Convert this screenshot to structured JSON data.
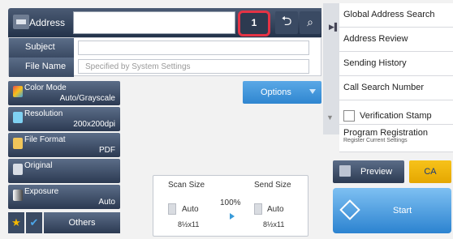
{
  "address": {
    "label": "Address",
    "count": "1"
  },
  "subject": {
    "label": "Subject"
  },
  "file_name": {
    "label": "File Name",
    "placeholder": "Specified by System Settings"
  },
  "modes": [
    {
      "title": "Color Mode",
      "value": "Auto/Grayscale"
    },
    {
      "title": "Resolution",
      "value": "200x200dpi"
    },
    {
      "title": "File Format",
      "value": "PDF"
    },
    {
      "title": "Original",
      "value": ""
    },
    {
      "title": "Exposure",
      "value": "Auto"
    }
  ],
  "options_label": "Options",
  "scan_panel": {
    "scan_size_label": "Scan Size",
    "send_size_label": "Send Size",
    "ratio": "100%",
    "scan_auto": "Auto",
    "send_auto": "Auto",
    "scan_paper": "8½x11",
    "send_paper": "8½x11"
  },
  "others_label": "Others",
  "right_menu": [
    {
      "label": "Global Address Search"
    },
    {
      "label": "Address Review"
    },
    {
      "label": "Sending History"
    },
    {
      "label": "Call Search Number"
    },
    {
      "label": "Verification Stamp"
    },
    {
      "label": "Program Registration",
      "sub": "Register Current Settings"
    }
  ],
  "preview_label": "Preview",
  "ca_label": "CA",
  "start_label": "Start",
  "colors": {
    "accent": "#2f86d0",
    "highlight_border": "#e53345",
    "ca_yellow": "#f7c21a"
  }
}
